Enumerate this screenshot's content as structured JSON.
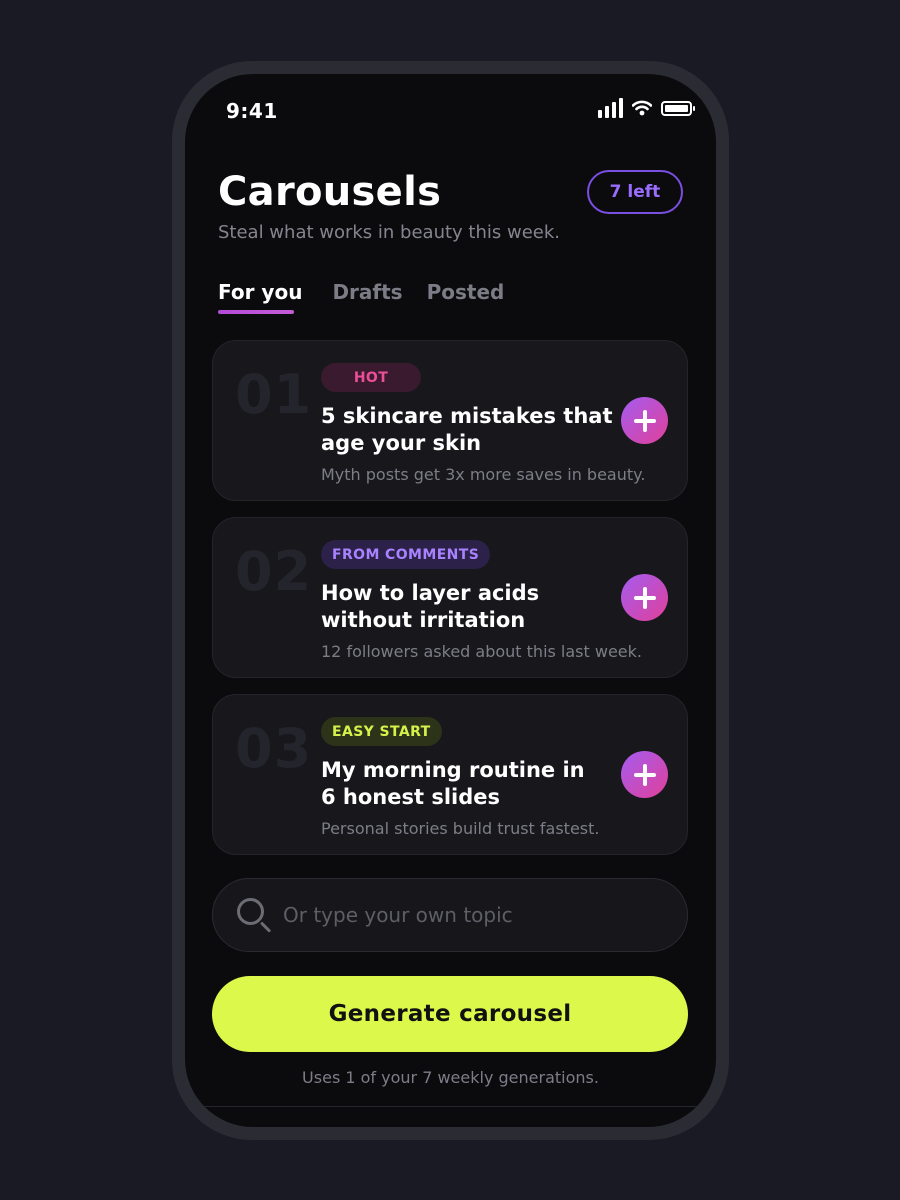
{
  "status_bar": {
    "time": "9:41"
  },
  "header": {
    "title": "Carousels",
    "quota_badge": "7 left",
    "subtitle": "Steal what works in beauty this week."
  },
  "tabs": [
    {
      "label": "For you",
      "active": true
    },
    {
      "label": "Drafts",
      "active": false
    },
    {
      "label": "Posted",
      "active": false
    }
  ],
  "cards": [
    {
      "number": "01",
      "tag": "HOT",
      "title_line1": "5 skincare mistakes that",
      "title_line2": "age your skin",
      "note": "Myth posts get 3x more saves in beauty."
    },
    {
      "number": "02",
      "tag": "FROM COMMENTS",
      "title_line1": "How to layer acids",
      "title_line2": "without irritation",
      "note": "12 followers asked about this last week."
    },
    {
      "number": "03",
      "tag": "EASY START",
      "title_line1": "My morning routine in",
      "title_line2": "6 honest slides",
      "note": "Personal stories build trust fastest."
    }
  ],
  "search": {
    "placeholder": "Or type your own topic",
    "value": ""
  },
  "generate": {
    "label": "Generate carousel",
    "usage_note": "Uses 1 of your 7 weekly generations."
  },
  "colors": {
    "accent_lime": "#dcf84b",
    "accent_purple": "#7a4fe0",
    "hot_pink": "#ec4f9a",
    "tag_purple": "#a882ff",
    "tag_lime": "#d6f14a"
  },
  "icons": [
    "cellular-signal-icon",
    "wifi-icon",
    "battery-icon",
    "plus-icon",
    "search-icon"
  ]
}
